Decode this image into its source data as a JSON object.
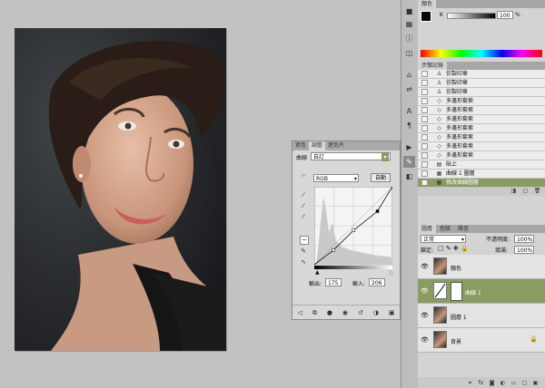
{
  "colors": {
    "accent": "#8a9c61",
    "panel": "#d3d3d3",
    "canvas": "#c2c2c2"
  },
  "color_panel": {
    "tab": "顏色",
    "k_label": "K",
    "k_value": "100",
    "k_unit": "%"
  },
  "history": {
    "tab": "步驟記錄",
    "items": [
      {
        "icon": "stamp-icon",
        "label": "仿製印章"
      },
      {
        "icon": "stamp-icon",
        "label": "仿製印章"
      },
      {
        "icon": "stamp-icon",
        "label": "仿製印章"
      },
      {
        "icon": "lasso-icon",
        "label": "多邊形套索"
      },
      {
        "icon": "lasso-icon",
        "label": "多邊形套索"
      },
      {
        "icon": "lasso-icon",
        "label": "多邊形套索"
      },
      {
        "icon": "lasso-icon",
        "label": "多邊形套索"
      },
      {
        "icon": "lasso-icon",
        "label": "多邊形套索"
      },
      {
        "icon": "lasso-icon",
        "label": "多邊形套索"
      },
      {
        "icon": "lasso-icon",
        "label": "多邊形套索"
      },
      {
        "icon": "paste-icon",
        "label": "貼上"
      },
      {
        "icon": "layer-icon",
        "label": "曲線 1 圖層"
      },
      {
        "icon": "layer-icon",
        "label": "修改曲線圖層",
        "active": true
      }
    ]
  },
  "layers": {
    "tabs": [
      "圖層",
      "色版",
      "路徑"
    ],
    "blend_mode": "正常",
    "opacity_label": "不透明度:",
    "opacity_value": "100%",
    "lock_label": "鎖定:",
    "fill_label": "填滿:",
    "fill_value": "100%",
    "items": [
      {
        "name": "顏色",
        "thumb": "photo"
      },
      {
        "name": "曲線 1",
        "thumb": "curve",
        "active": true
      },
      {
        "name": "圖層 1",
        "thumb": "photo"
      },
      {
        "name": "背景",
        "thumb": "photo",
        "locked": true
      }
    ]
  },
  "adjust": {
    "tabs": [
      "遮色",
      "調整",
      "遮色片"
    ],
    "active_tab": 1,
    "title": "曲線",
    "preset": "自訂",
    "channel": "RGB",
    "auto_label": "自動",
    "output_label": "輸出:",
    "output_value": "175",
    "input_label": "輸入:",
    "input_value": "206"
  },
  "chart_data": {
    "type": "line",
    "series": [
      {
        "x": [
          0,
          63,
          128,
          206,
          255
        ],
        "y": [
          0,
          48,
          112,
          175,
          255
        ]
      }
    ],
    "xlim": [
      0,
      255
    ],
    "ylim": [
      0,
      255
    ]
  }
}
